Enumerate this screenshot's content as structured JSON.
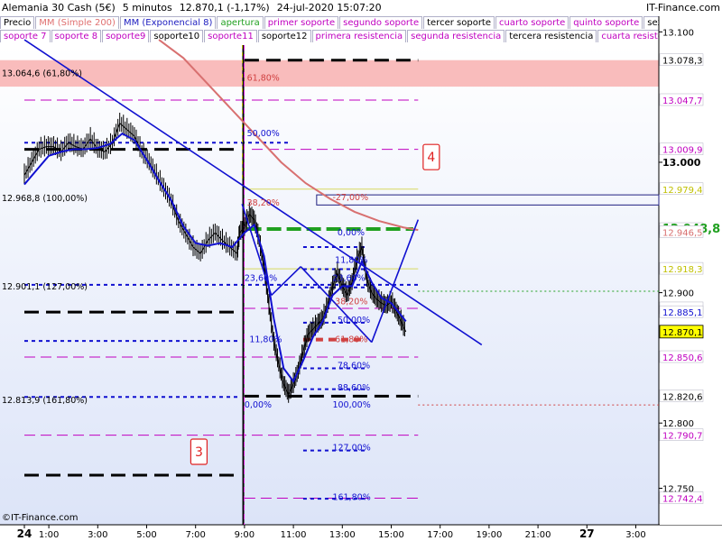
{
  "header": {
    "instrument": "Alemania 30 Cash (5€)",
    "timeframe": "5 minutos",
    "last": "12.870,1 (-1,17%)",
    "datetime": "24-jul-2020 15:07:20",
    "site": "IT-Finance.com",
    "copyright": "©IT-Finance.com"
  },
  "legend": {
    "row1": [
      {
        "label": "Precio",
        "color": "#000000"
      },
      {
        "label": "MM (Simple 200)",
        "color": "#e07070"
      },
      {
        "label": "MM (Exponencial 8)",
        "color": "#2020c0"
      },
      {
        "label": "apertura",
        "color": "#20a020"
      },
      {
        "label": "primer soporte",
        "color": "#c000c0"
      },
      {
        "label": "segundo soporte",
        "color": "#c000c0"
      },
      {
        "label": "tercer soporte",
        "color": "#000000"
      },
      {
        "label": "cuarto soporte",
        "color": "#c000c0"
      },
      {
        "label": "quinto soporte",
        "color": "#c000c0"
      },
      {
        "label": "sexto soporte",
        "color": "#000000"
      }
    ],
    "row2": [
      {
        "label": "soporte 7",
        "color": "#c000c0"
      },
      {
        "label": "soporte 8",
        "color": "#c000c0"
      },
      {
        "label": "soporte9",
        "color": "#c000c0"
      },
      {
        "label": "soporte10",
        "color": "#000000"
      },
      {
        "label": "soporte11",
        "color": "#c000c0"
      },
      {
        "label": "soporte12",
        "color": "#000000"
      },
      {
        "label": "primera resistencia",
        "color": "#c000c0"
      },
      {
        "label": "segunda resistencia",
        "color": "#c000c0"
      },
      {
        "label": "tercera resistencia",
        "color": "#000000"
      },
      {
        "label": "cuarta resistencia",
        "color": "#c000c0"
      },
      {
        "label": "quinta",
        "color": "#c000c0"
      }
    ]
  },
  "colors": {
    "price": "#000000",
    "sma200": "#d87070",
    "ema8": "#1010d0",
    "trend": "#1010d0",
    "open": "#20a020",
    "support": "#c000c0",
    "support_strong": "#000000",
    "fib_blue": "#1010d0",
    "fib_red": "#d04040",
    "resistance_zone": "#f8b0b0",
    "background_top": "#ffffff",
    "background_bottom": "#dce4f8"
  },
  "chart_data": {
    "type": "line",
    "ylim": [
      12722,
      13112
    ],
    "x_range_hours": [
      0,
      41.2
    ],
    "x_ticks": [
      {
        "label": "24",
        "x": 0,
        "bold": true
      },
      {
        "label": "1:00",
        "x": 1
      },
      {
        "label": "3:00",
        "x": 3
      },
      {
        "label": "5:00",
        "x": 5
      },
      {
        "label": "7:00",
        "x": 7
      },
      {
        "label": "9:00",
        "x": 9
      },
      {
        "label": "11:00",
        "x": 11
      },
      {
        "label": "13:00",
        "x": 13
      },
      {
        "label": "15:00",
        "x": 15
      },
      {
        "label": "17:00",
        "x": 17
      },
      {
        "label": "19:00",
        "x": 19
      },
      {
        "label": "21:00",
        "x": 21
      },
      {
        "label": "27",
        "x": 23,
        "bold": true
      },
      {
        "label": "3:00",
        "x": 25
      }
    ],
    "y_ticks": [
      {
        "v": 13100,
        "label": "13.100"
      },
      {
        "v": 13000,
        "label": "13.000",
        "bold": true
      },
      {
        "v": 12900,
        "label": "12.900"
      },
      {
        "v": 12800,
        "label": "12.800"
      },
      {
        "v": 12750,
        "label": "12.750"
      }
    ],
    "price_labels": [
      {
        "v": 13078.3,
        "label": "13.078,3",
        "color": "#000000"
      },
      {
        "v": 13047.7,
        "label": "13.047,7",
        "color": "#c000c0"
      },
      {
        "v": 13009.9,
        "label": "13.009,9",
        "color": "#c000c0"
      },
      {
        "v": 12979.4,
        "label": "12.979,4",
        "color": "#c0c000"
      },
      {
        "v": 12948.8,
        "label": "12.948,8",
        "color": "#20a020",
        "big": true
      },
      {
        "v": 12946.5,
        "label": "12.946,5",
        "color": "#d87070"
      },
      {
        "v": 12918.3,
        "label": "12.918,3",
        "color": "#c0c000"
      },
      {
        "v": 12888.0,
        "label": "12.888,0",
        "color": "#c000c0"
      },
      {
        "v": 12885.1,
        "label": "12.885,1",
        "color": "#1010d0"
      },
      {
        "v": 12870.1,
        "label": "12.870,1",
        "color": "#000000",
        "highlight": true
      },
      {
        "v": 12850.6,
        "label": "12.850,6",
        "color": "#c000c0"
      },
      {
        "v": 12820.6,
        "label": "12.820,6",
        "color": "#000000"
      },
      {
        "v": 12790.7,
        "label": "12.790,7",
        "color": "#c000c0"
      },
      {
        "v": 12742.4,
        "label": "12.742,4",
        "color": "#c000c0"
      }
    ],
    "left_fib_labels": [
      {
        "v": 13064.6,
        "label": "13.064,6 (61,80%)"
      },
      {
        "v": 12968.8,
        "label": "12.968,8 (100,00%)"
      },
      {
        "v": 12901.1,
        "label": "12.901,1 (127,00%)"
      },
      {
        "v": 12813.9,
        "label": "12.813,9 (161,80%)"
      }
    ],
    "fib_labels_upper": [
      {
        "v": 13064.6,
        "x": 9.1,
        "label": "61,80%",
        "color": "#d04040"
      },
      {
        "v": 13022,
        "x": 9.1,
        "label": "50,00%",
        "color": "#1010d0"
      },
      {
        "v": 12968.8,
        "x": 9.1,
        "label": "38,20%",
        "color": "#d04040"
      },
      {
        "v": 12973,
        "x": 12.6,
        "label": "-27,00%",
        "color": "#d04040"
      }
    ],
    "fib_labels_lower": [
      {
        "v": 12946,
        "x": 12.8,
        "label": "0,00%",
        "color": "#1010d0"
      },
      {
        "v": 12925,
        "x": 12.7,
        "label": "11,80%",
        "color": "#1010d0"
      },
      {
        "v": 12911,
        "x": 9.0,
        "label": "23,60%",
        "color": "#1010d0"
      },
      {
        "v": 12911,
        "x": 12.6,
        "label": "23,60%",
        "color": "#1010d0"
      },
      {
        "v": 12893,
        "x": 12.7,
        "label": "38,20%",
        "color": "#d04040"
      },
      {
        "v": 12879,
        "x": 12.8,
        "label": "50,00%",
        "color": "#1010d0"
      },
      {
        "v": 12864,
        "x": 9.2,
        "label": "11,80%",
        "color": "#1010d0"
      },
      {
        "v": 12864,
        "x": 12.7,
        "label": "61,80%",
        "color": "#d04040"
      },
      {
        "v": 12844,
        "x": 12.8,
        "label": "78,60%",
        "color": "#1010d0"
      },
      {
        "v": 12827,
        "x": 12.8,
        "label": "88,60%",
        "color": "#1010d0"
      },
      {
        "v": 12814,
        "x": 9.0,
        "label": "0,00%",
        "color": "#1010d0"
      },
      {
        "v": 12814,
        "x": 12.6,
        "label": "100,00%",
        "color": "#1010d0"
      },
      {
        "v": 12781,
        "x": 12.6,
        "label": "127,00%",
        "color": "#1010d0"
      },
      {
        "v": 12743,
        "x": 12.6,
        "label": "161,80%",
        "color": "#1010d0"
      }
    ],
    "annotations": [
      {
        "label": "3",
        "x": 7.1,
        "v": 12778
      },
      {
        "label": "4",
        "x": 16.6,
        "v": 13004
      }
    ],
    "session_open_x": 8.95,
    "resistance_zone": [
      13058,
      13078.3
    ],
    "support_lines": [
      {
        "v": 13047.7,
        "x0": 0,
        "x1": 16.1,
        "style": "dash-mag"
      },
      {
        "v": 13009.9,
        "x0": 9.3,
        "x1": 16.1,
        "style": "dash-mag"
      },
      {
        "v": 12979.4,
        "x0": 9.0,
        "x1": 16.1,
        "style": "yellow"
      },
      {
        "v": 12918.3,
        "x0": 9.0,
        "x1": 16.1,
        "style": "yellow"
      },
      {
        "v": 12888.0,
        "x0": 9.0,
        "x1": 16.1,
        "style": "dash-mag"
      },
      {
        "v": 12850.6,
        "x0": 0,
        "x1": 16.1,
        "style": "dash-mag"
      },
      {
        "v": 12790.7,
        "x0": 0,
        "x1": 16.1,
        "style": "dash-mag"
      },
      {
        "v": 12742.4,
        "x0": 9.0,
        "x1": 16.1,
        "style": "dash-mag"
      },
      {
        "v": 13078.3,
        "x0": 9.0,
        "x1": 16.1,
        "style": "black-heavy"
      },
      {
        "v": 13009.9,
        "x0": 0,
        "x1": 8.8,
        "style": "black-heavy"
      },
      {
        "v": 12885.1,
        "x0": 0,
        "x1": 8.8,
        "style": "black-heavy"
      },
      {
        "v": 12820.6,
        "x0": 9.0,
        "x1": 16.1,
        "style": "black-heavy"
      },
      {
        "v": 12760,
        "x0": 0,
        "x1": 8.8,
        "style": "black-heavy"
      },
      {
        "v": 12948.8,
        "x0": 9.1,
        "x1": 15.9,
        "style": "green-heavy"
      },
      {
        "v": 13015,
        "x0": 0,
        "x1": 10.8,
        "style": "blue-dot"
      },
      {
        "v": 12906,
        "x0": 0,
        "x1": 16.1,
        "style": "blue-dot"
      },
      {
        "v": 12863,
        "x0": 0,
        "x1": 8.8,
        "style": "blue-dot"
      },
      {
        "v": 12820,
        "x0": 0,
        "x1": 8.8,
        "style": "blue-dot"
      },
      {
        "v": 12935,
        "x0": 11.4,
        "x1": 14.0,
        "style": "blue-dot"
      },
      {
        "v": 12918,
        "x0": 11.4,
        "x1": 14.0,
        "style": "blue-dot"
      },
      {
        "v": 12904,
        "x0": 11.4,
        "x1": 14.0,
        "style": "blue-dot"
      },
      {
        "v": 12877,
        "x0": 11.4,
        "x1": 14.0,
        "style": "blue-dot"
      },
      {
        "v": 12864,
        "x0": 11.4,
        "x1": 14.0,
        "style": "red-heavy"
      },
      {
        "v": 12842,
        "x0": 11.4,
        "x1": 14.0,
        "style": "blue-dot"
      },
      {
        "v": 12826,
        "x0": 11.4,
        "x1": 14.0,
        "style": "blue-dot"
      },
      {
        "v": 12779,
        "x0": 11.4,
        "x1": 14.0,
        "style": "blue-dot"
      },
      {
        "v": 12742,
        "x0": 11.4,
        "x1": 14.0,
        "style": "blue-dot"
      },
      {
        "v": 12901.1,
        "x0": 16.1,
        "x1": 41.2,
        "style": "green-dot"
      },
      {
        "v": 12813.9,
        "x0": 16.1,
        "x1": 41.2,
        "style": "red-dot"
      }
    ],
    "fib_boxes": [
      {
        "x0": 11.95,
        "x1": 41.2,
        "v0": 12975,
        "v1": 12970
      }
    ],
    "trend_lines": [
      {
        "x0": 0,
        "v0": 13094,
        "x1": 18.7,
        "v1": 12860
      },
      {
        "x0": 8.9,
        "v0": 12968,
        "x1": 10.1,
        "v1": 12898
      },
      {
        "x0": 10.1,
        "v0": 12898,
        "x1": 11.3,
        "v1": 12920
      },
      {
        "x0": 11.3,
        "v0": 12920,
        "x1": 14.2,
        "v1": 12862
      },
      {
        "x0": 14.2,
        "v0": 12862,
        "x1": 16.1,
        "v1": 12956
      }
    ],
    "price_series": [
      [
        0,
        12990
      ],
      [
        0.3,
        13000
      ],
      [
        0.6,
        13010
      ],
      [
        0.9,
        13012
      ],
      [
        1.2,
        13012
      ],
      [
        1.5,
        13008
      ],
      [
        1.8,
        13015
      ],
      [
        2.1,
        13012
      ],
      [
        2.4,
        13010
      ],
      [
        2.7,
        13018
      ],
      [
        3.0,
        13010
      ],
      [
        3.3,
        13008
      ],
      [
        3.6,
        13015
      ],
      [
        3.9,
        13030
      ],
      [
        4.2,
        13025
      ],
      [
        4.5,
        13020
      ],
      [
        4.8,
        13008
      ],
      [
        5.1,
        13000
      ],
      [
        5.4,
        12990
      ],
      [
        5.7,
        12980
      ],
      [
        6.0,
        12970
      ],
      [
        6.3,
        12955
      ],
      [
        6.6,
        12945
      ],
      [
        6.9,
        12935
      ],
      [
        7.2,
        12930
      ],
      [
        7.5,
        12940
      ],
      [
        7.8,
        12946
      ],
      [
        8.1,
        12940
      ],
      [
        8.4,
        12935
      ],
      [
        8.7,
        12930
      ],
      [
        8.8,
        12946
      ],
      [
        9.0,
        12950
      ],
      [
        9.2,
        12960
      ],
      [
        9.4,
        12956
      ],
      [
        9.6,
        12940
      ],
      [
        9.8,
        12920
      ],
      [
        10.0,
        12890
      ],
      [
        10.2,
        12862
      ],
      [
        10.4,
        12845
      ],
      [
        10.6,
        12830
      ],
      [
        10.8,
        12822
      ],
      [
        11.0,
        12830
      ],
      [
        11.2,
        12840
      ],
      [
        11.4,
        12855
      ],
      [
        11.6,
        12868
      ],
      [
        11.8,
        12872
      ],
      [
        12.0,
        12876
      ],
      [
        12.2,
        12880
      ],
      [
        12.4,
        12890
      ],
      [
        12.6,
        12905
      ],
      [
        12.8,
        12915
      ],
      [
        13.0,
        12905
      ],
      [
        13.2,
        12898
      ],
      [
        13.4,
        12908
      ],
      [
        13.6,
        12925
      ],
      [
        13.8,
        12935
      ],
      [
        14.0,
        12910
      ],
      [
        14.2,
        12900
      ],
      [
        14.4,
        12895
      ],
      [
        14.6,
        12892
      ],
      [
        14.8,
        12890
      ],
      [
        15.0,
        12893
      ],
      [
        15.2,
        12886
      ],
      [
        15.4,
        12878
      ],
      [
        15.6,
        12870
      ]
    ],
    "ema8_series": [
      [
        0,
        12983
      ],
      [
        0.5,
        12994
      ],
      [
        1.0,
        13005
      ],
      [
        1.5,
        13008
      ],
      [
        2.0,
        13010
      ],
      [
        2.5,
        13010
      ],
      [
        3.0,
        13011
      ],
      [
        3.5,
        13014
      ],
      [
        4.0,
        13022
      ],
      [
        4.5,
        13017
      ],
      [
        5.0,
        13002
      ],
      [
        5.5,
        12986
      ],
      [
        6.0,
        12971
      ],
      [
        6.5,
        12951
      ],
      [
        7.0,
        12938
      ],
      [
        7.5,
        12936
      ],
      [
        8.0,
        12938
      ],
      [
        8.5,
        12935
      ],
      [
        9.0,
        12946
      ],
      [
        9.4,
        12952
      ],
      [
        9.8,
        12928
      ],
      [
        10.2,
        12880
      ],
      [
        10.6,
        12842
      ],
      [
        11.0,
        12832
      ],
      [
        11.4,
        12848
      ],
      [
        11.8,
        12866
      ],
      [
        12.2,
        12878
      ],
      [
        12.6,
        12898
      ],
      [
        13.0,
        12905
      ],
      [
        13.4,
        12905
      ],
      [
        13.8,
        12924
      ],
      [
        14.2,
        12908
      ],
      [
        14.6,
        12896
      ],
      [
        15.0,
        12892
      ],
      [
        15.6,
        12878
      ]
    ],
    "sma200_series": [
      [
        5.5,
        13094
      ],
      [
        6.5,
        13080
      ],
      [
        7.5,
        13060
      ],
      [
        8.5,
        13040
      ],
      [
        9.5,
        13020
      ],
      [
        10.5,
        13000
      ],
      [
        11.5,
        12984
      ],
      [
        12.5,
        12972
      ],
      [
        13.5,
        12962
      ],
      [
        14.5,
        12955
      ],
      [
        15.5,
        12950
      ],
      [
        16.1,
        12948
      ]
    ]
  }
}
